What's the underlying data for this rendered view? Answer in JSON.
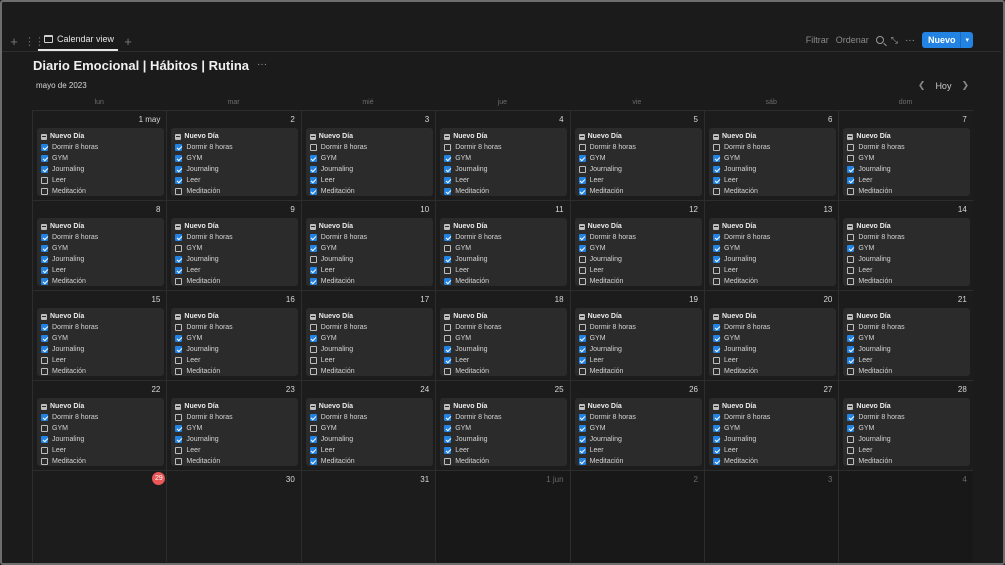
{
  "toolbar": {
    "tab_label": "Calendar view",
    "filter": "Filtrar",
    "sort": "Ordenar",
    "new_label": "Nuevo"
  },
  "page": {
    "title": "Diario Emocional | Hábitos | Rutina",
    "month": "mayo de 2023",
    "today_label": "Hoy"
  },
  "weekdays": [
    "lun",
    "mar",
    "mié",
    "jue",
    "vie",
    "sáb",
    "dom"
  ],
  "card_title": "Nuevo Día",
  "habits": [
    "Dormir 8 horas",
    "GYM",
    "Journaling",
    "Leer",
    "Meditación"
  ],
  "colors": {
    "accent": "#2383e2",
    "today": "#eb5757",
    "background": "#1b1b1b",
    "card": "#2b2b2b"
  },
  "weeks": [
    [
      {
        "label": "1 may",
        "checks": [
          1,
          1,
          1,
          0,
          0
        ]
      },
      {
        "label": "2",
        "checks": [
          1,
          1,
          1,
          1,
          0
        ]
      },
      {
        "label": "3",
        "checks": [
          0,
          1,
          1,
          1,
          1
        ]
      },
      {
        "label": "4",
        "checks": [
          0,
          1,
          1,
          1,
          1
        ]
      },
      {
        "label": "5",
        "checks": [
          0,
          1,
          0,
          1,
          1
        ]
      },
      {
        "label": "6",
        "checks": [
          0,
          1,
          1,
          1,
          0
        ]
      },
      {
        "label": "7",
        "checks": [
          0,
          0,
          1,
          1,
          0
        ]
      }
    ],
    [
      {
        "label": "8",
        "checks": [
          1,
          1,
          1,
          1,
          1
        ]
      },
      {
        "label": "9",
        "checks": [
          1,
          0,
          1,
          1,
          0
        ]
      },
      {
        "label": "10",
        "checks": [
          1,
          1,
          0,
          1,
          1
        ]
      },
      {
        "label": "11",
        "checks": [
          1,
          0,
          1,
          0,
          1
        ]
      },
      {
        "label": "12",
        "checks": [
          1,
          1,
          0,
          0,
          0
        ]
      },
      {
        "label": "13",
        "checks": [
          1,
          1,
          1,
          0,
          0
        ]
      },
      {
        "label": "14",
        "checks": [
          0,
          1,
          0,
          0,
          0
        ]
      }
    ],
    [
      {
        "label": "15",
        "checks": [
          1,
          1,
          1,
          0,
          0
        ]
      },
      {
        "label": "16",
        "checks": [
          0,
          1,
          1,
          0,
          0
        ]
      },
      {
        "label": "17",
        "checks": [
          0,
          1,
          0,
          0,
          0
        ]
      },
      {
        "label": "18",
        "checks": [
          0,
          0,
          1,
          1,
          0
        ]
      },
      {
        "label": "19",
        "checks": [
          0,
          1,
          1,
          1,
          0
        ]
      },
      {
        "label": "20",
        "checks": [
          1,
          1,
          1,
          0,
          0
        ]
      },
      {
        "label": "21",
        "checks": [
          0,
          1,
          1,
          1,
          0
        ]
      }
    ],
    [
      {
        "label": "22",
        "checks": [
          1,
          0,
          1,
          0,
          0
        ]
      },
      {
        "label": "23",
        "checks": [
          0,
          1,
          1,
          0,
          0
        ]
      },
      {
        "label": "24",
        "checks": [
          1,
          0,
          1,
          1,
          1
        ]
      },
      {
        "label": "25",
        "checks": [
          1,
          1,
          1,
          1,
          0
        ]
      },
      {
        "label": "26",
        "checks": [
          1,
          1,
          1,
          1,
          1
        ]
      },
      {
        "label": "27",
        "checks": [
          1,
          1,
          1,
          1,
          1
        ]
      },
      {
        "label": "28",
        "checks": [
          1,
          1,
          0,
          0,
          0
        ]
      }
    ],
    [
      {
        "label": "29",
        "today": true
      },
      {
        "label": "30"
      },
      {
        "label": "31"
      },
      {
        "label": "1 jun",
        "other": true
      },
      {
        "label": "2",
        "other": true
      },
      {
        "label": "3",
        "other": true
      },
      {
        "label": "4",
        "other": true
      }
    ]
  ]
}
